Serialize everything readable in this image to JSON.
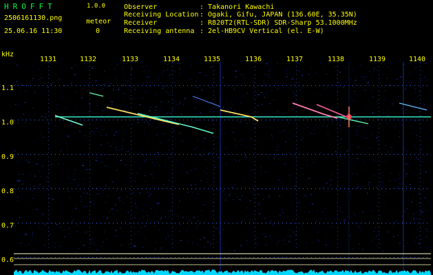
{
  "header": {
    "app_name": "HROFFT",
    "version": "1.0.0",
    "filename": "2506161130.png",
    "datetime": "25.06.16 11:30",
    "meteor_label": "meteor",
    "meteor_count": "0"
  },
  "info": [
    {
      "label": "Observer",
      "value": ": Takanori Kawachi"
    },
    {
      "label": "Receiving Location",
      "value": ": Ogaki, Gifu, JAPAN (136.60E, 35.35N)"
    },
    {
      "label": "Receiver",
      "value": ": R820T2(RTL-SDR) SDR-Sharp 53.1000MHz"
    },
    {
      "label": "Receiving antenna",
      "value": ": 2el-HB9CV Vertical (el. E-W)"
    }
  ],
  "axes": {
    "y_unit": "kHz",
    "x_ticks": [
      "1131",
      "1132",
      "1133",
      "1134",
      "1135",
      "1136",
      "1137",
      "1138",
      "1139",
      "1140"
    ],
    "y_ticks": [
      "1.1",
      "1.0",
      "0.9",
      "0.8",
      "0.7",
      "0.6"
    ]
  },
  "colors": {
    "background": "#000000",
    "label_yellow": "#ffff00",
    "title_green": "#00ff44",
    "carrier": "#40ffe0",
    "noise_floor": "#00d8ff",
    "grid_dot": "#3a6cff"
  }
}
